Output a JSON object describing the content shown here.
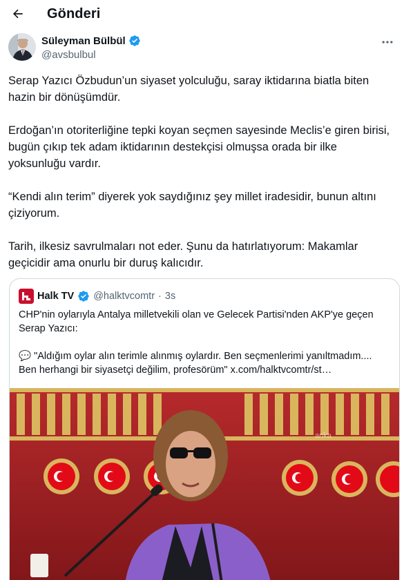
{
  "header": {
    "title": "Gönderi"
  },
  "author": {
    "name": "Süleyman Bülbül",
    "handle": "@avsbulbul"
  },
  "tweet": {
    "paragraphs": [
      "Serap Yazıcı Özbudun’un siyaset yolculuğu, saray iktidarına biatla biten hazin bir dönüşümdür.",
      "Erdoğan’ın otoriterliğine tepki koyan seçmen sayesinde Meclis’e giren birisi, bugün çıkıp tek adam iktidarının destekçisi olmuşsa orada bir ilke yoksunluğu vardır.",
      "“Kendi alın terim” diyerek yok saydığınız şey millet iradesidir, bunun altını çiziyorum.",
      "Tarih, ilkesiz savrulmaları not eder. Şunu da hatırlatıyorum: Makamlar geçicidir ama onurlu bir duruş kalıcıdır."
    ]
  },
  "quote": {
    "name": "Halk TV",
    "handle": "@halktvcomtr",
    "separator": "·",
    "time": "3s",
    "text_line1": "CHP'nin oylarıyla Antalya milletvekili olan ve Gelecek Partisi'nden AKP'ye geçen Serap Yazıcı:",
    "speech_emoji": "💬",
    "text_quote": "\"Aldığım oylar alın terimle alınmış oylardır. Ben seçmenlerimi yanıltmadım.... Ben herhangi bir siyasetçi değilim, profesörüm\"",
    "link": "x.com/halktvcomtr/st…",
    "watermark": "anka"
  },
  "colors": {
    "verified_blue": "#1d9bf0",
    "secondary_text": "#536471",
    "border": "#cfd9de",
    "halktv_red": "#c8102e"
  },
  "icons": [
    "back-arrow-icon",
    "verified-badge-icon",
    "more-options-icon",
    "speech-bubble-icon"
  ]
}
